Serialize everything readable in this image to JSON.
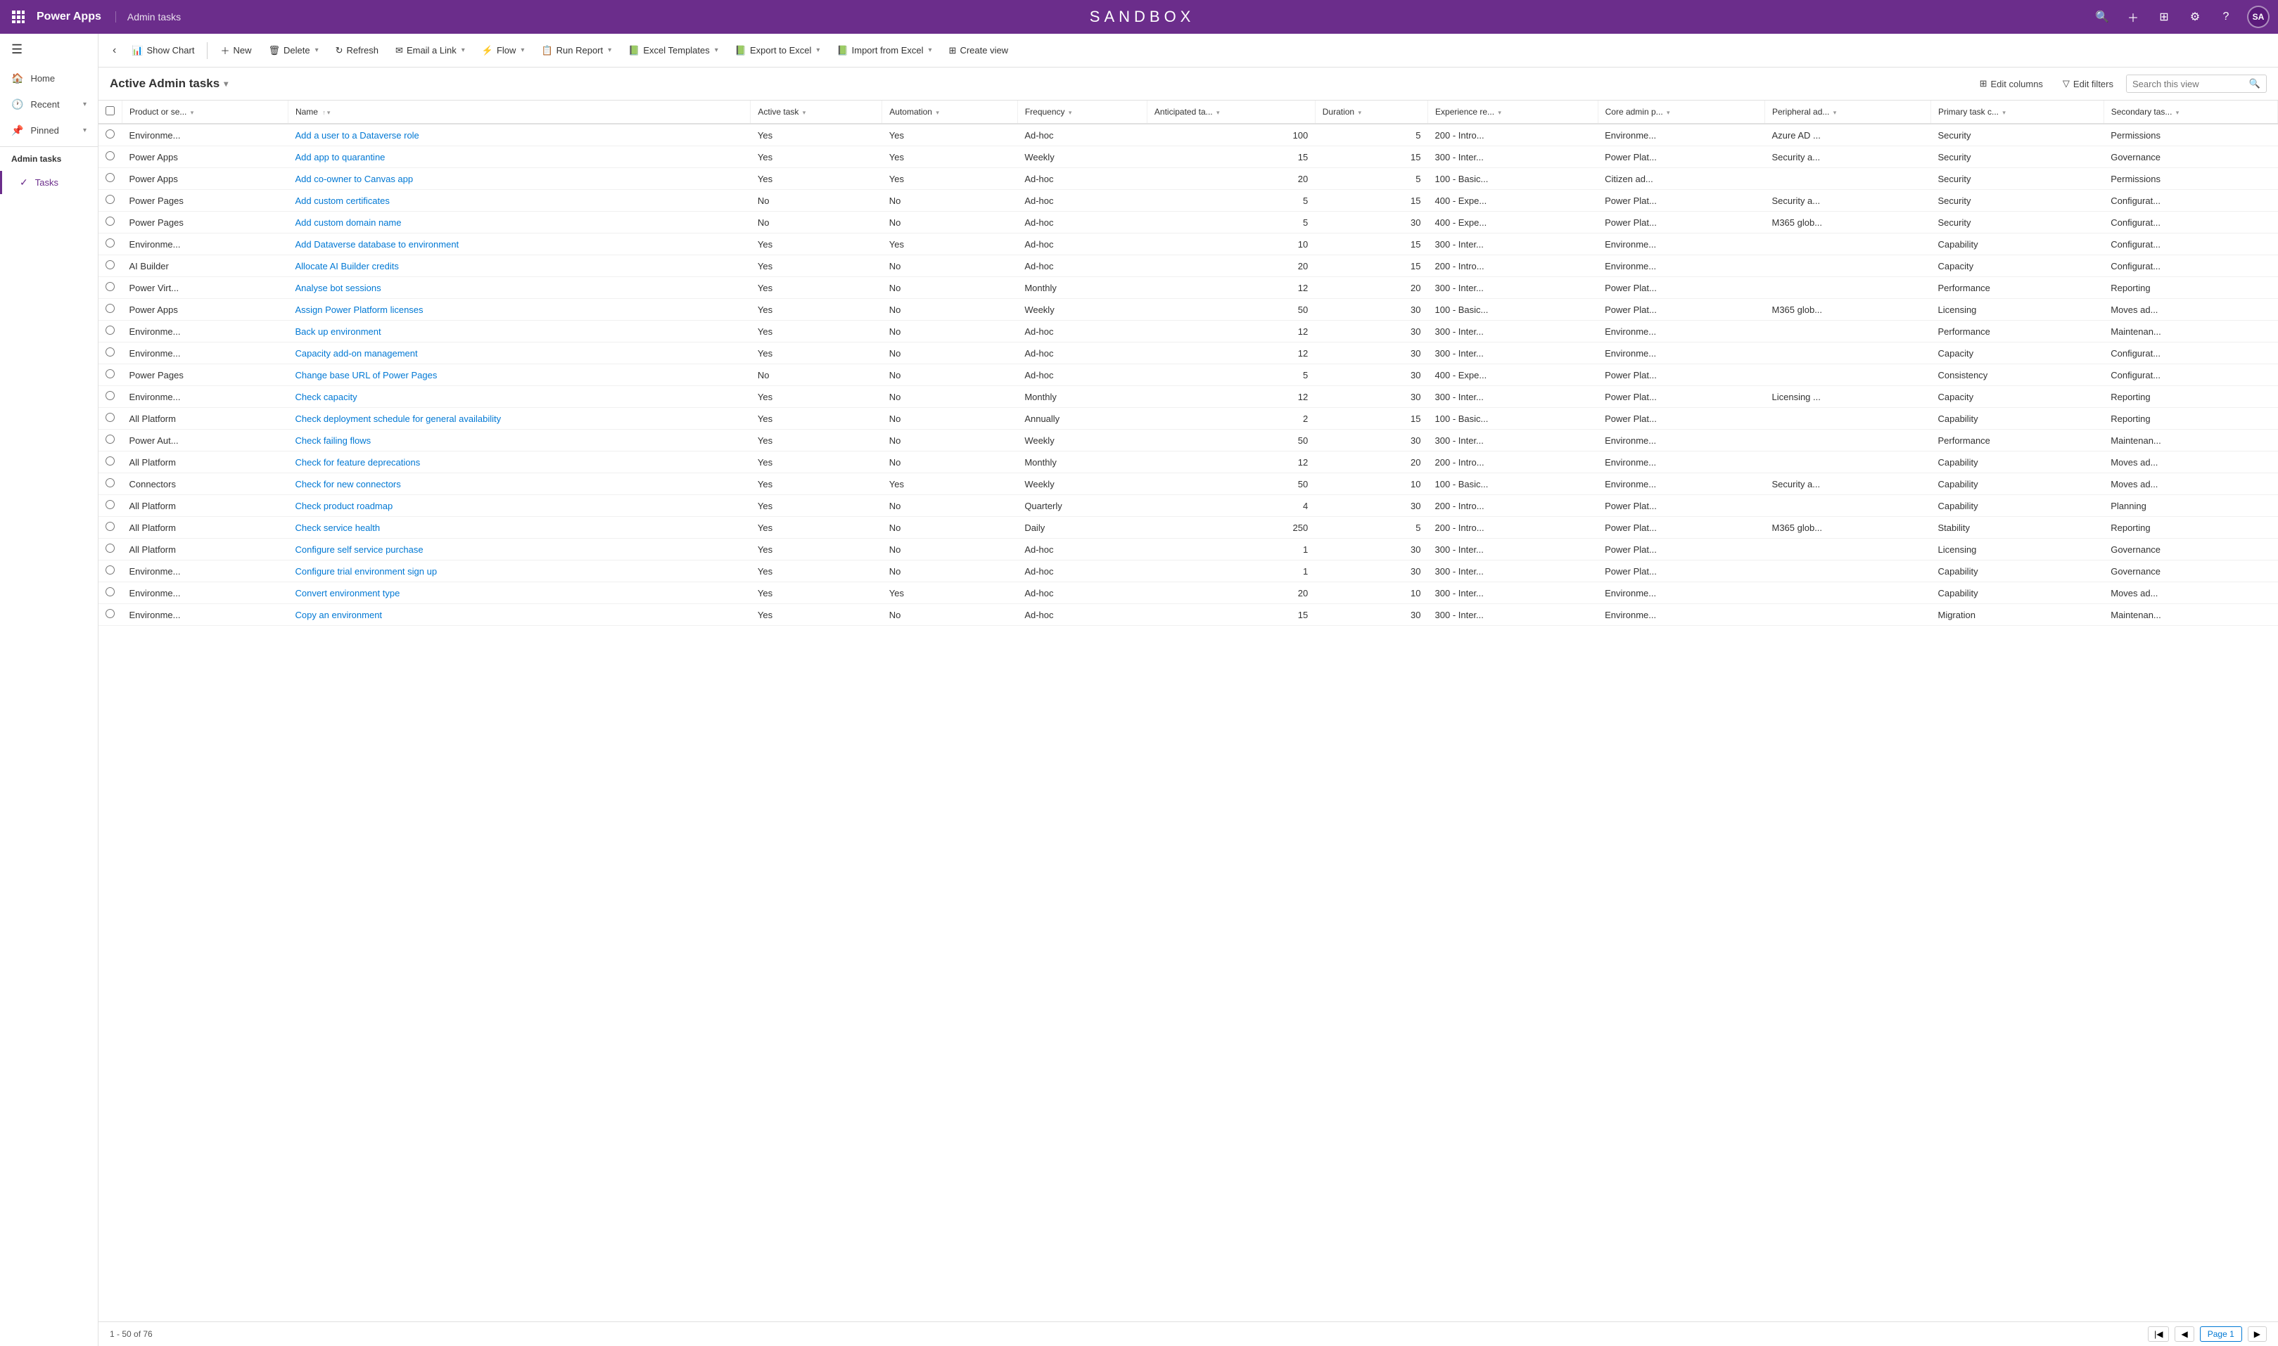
{
  "topNav": {
    "appName": "Power Apps",
    "sectionTitle": "Admin tasks",
    "sandboxTitle": "SANDBOX",
    "avatarInitials": "SA"
  },
  "sidebar": {
    "toggleIcon": "☰",
    "items": [
      {
        "id": "home",
        "label": "Home",
        "icon": "🏠"
      },
      {
        "id": "recent",
        "label": "Recent",
        "icon": "🕐",
        "hasArrow": true
      },
      {
        "id": "pinned",
        "label": "Pinned",
        "icon": "📌",
        "hasArrow": true
      }
    ],
    "section": {
      "label": "Admin tasks",
      "subItems": [
        {
          "id": "tasks",
          "label": "Tasks",
          "icon": "✓",
          "active": true
        }
      ]
    }
  },
  "commandBar": {
    "backLabel": "‹",
    "showChartLabel": "Show Chart",
    "newLabel": "New",
    "deleteLabel": "Delete",
    "refreshLabel": "Refresh",
    "emailLinkLabel": "Email a Link",
    "flowLabel": "Flow",
    "runReportLabel": "Run Report",
    "excelTemplatesLabel": "Excel Templates",
    "exportToExcelLabel": "Export to Excel",
    "importFromExcelLabel": "Import from Excel",
    "createViewLabel": "Create view"
  },
  "viewHeader": {
    "title": "Active Admin tasks",
    "editColumnsLabel": "Edit columns",
    "editFiltersLabel": "Edit filters",
    "searchPlaceholder": "Search this view"
  },
  "table": {
    "columns": [
      {
        "id": "product",
        "label": "Product or se...",
        "hasFilter": true
      },
      {
        "id": "name",
        "label": "Name",
        "hasFilter": true
      },
      {
        "id": "activeTask",
        "label": "Active task",
        "hasFilter": true
      },
      {
        "id": "automation",
        "label": "Automation",
        "hasFilter": true
      },
      {
        "id": "frequency",
        "label": "Frequency",
        "hasFilter": true
      },
      {
        "id": "anticipatedTA",
        "label": "Anticipated ta...",
        "hasFilter": true
      },
      {
        "id": "duration",
        "label": "Duration",
        "hasFilter": true
      },
      {
        "id": "experienceRE",
        "label": "Experience re...",
        "hasFilter": true
      },
      {
        "id": "coreAdminP",
        "label": "Core admin p...",
        "hasFilter": true
      },
      {
        "id": "peripheralAD",
        "label": "Peripheral ad...",
        "hasFilter": true
      },
      {
        "id": "primaryTaskC",
        "label": "Primary task c...",
        "hasFilter": true
      },
      {
        "id": "secondaryTas",
        "label": "Secondary tas...",
        "hasFilter": true
      }
    ],
    "rows": [
      {
        "product": "Environme...",
        "name": "Add a user to a Dataverse role",
        "activeTask": "Yes",
        "automation": "Yes",
        "frequency": "Ad-hoc",
        "anticipatedTA": "100",
        "duration": "5",
        "experienceRE": "200 - Intro...",
        "coreAdminP": "Environme...",
        "peripheralAD": "Azure AD ...",
        "primaryTaskC": "Security",
        "secondaryTas": "Permissions"
      },
      {
        "product": "Power Apps",
        "name": "Add app to quarantine",
        "activeTask": "Yes",
        "automation": "Yes",
        "frequency": "Weekly",
        "anticipatedTA": "15",
        "duration": "15",
        "experienceRE": "300 - Inter...",
        "coreAdminP": "Power Plat...",
        "peripheralAD": "Security a...",
        "primaryTaskC": "Security",
        "secondaryTas": "Governance"
      },
      {
        "product": "Power Apps",
        "name": "Add co-owner to Canvas app",
        "activeTask": "Yes",
        "automation": "Yes",
        "frequency": "Ad-hoc",
        "anticipatedTA": "20",
        "duration": "5",
        "experienceRE": "100 - Basic...",
        "coreAdminP": "Citizen ad...",
        "peripheralAD": "",
        "primaryTaskC": "Security",
        "secondaryTas": "Permissions"
      },
      {
        "product": "Power Pages",
        "name": "Add custom certificates",
        "activeTask": "No",
        "automation": "No",
        "frequency": "Ad-hoc",
        "anticipatedTA": "5",
        "duration": "15",
        "experienceRE": "400 - Expe...",
        "coreAdminP": "Power Plat...",
        "peripheralAD": "Security a...",
        "primaryTaskC": "Security",
        "secondaryTas": "Configurat..."
      },
      {
        "product": "Power Pages",
        "name": "Add custom domain name",
        "activeTask": "No",
        "automation": "No",
        "frequency": "Ad-hoc",
        "anticipatedTA": "5",
        "duration": "30",
        "experienceRE": "400 - Expe...",
        "coreAdminP": "Power Plat...",
        "peripheralAD": "M365 glob...",
        "primaryTaskC": "Security",
        "secondaryTas": "Configurat..."
      },
      {
        "product": "Environme...",
        "name": "Add Dataverse database to environment",
        "activeTask": "Yes",
        "automation": "Yes",
        "frequency": "Ad-hoc",
        "anticipatedTA": "10",
        "duration": "15",
        "experienceRE": "300 - Inter...",
        "coreAdminP": "Environme...",
        "peripheralAD": "",
        "primaryTaskC": "Capability",
        "secondaryTas": "Configurat..."
      },
      {
        "product": "AI Builder",
        "name": "Allocate AI Builder credits",
        "activeTask": "Yes",
        "automation": "No",
        "frequency": "Ad-hoc",
        "anticipatedTA": "20",
        "duration": "15",
        "experienceRE": "200 - Intro...",
        "coreAdminP": "Environme...",
        "peripheralAD": "",
        "primaryTaskC": "Capacity",
        "secondaryTas": "Configurat..."
      },
      {
        "product": "Power Virt...",
        "name": "Analyse bot sessions",
        "activeTask": "Yes",
        "automation": "No",
        "frequency": "Monthly",
        "anticipatedTA": "12",
        "duration": "20",
        "experienceRE": "300 - Inter...",
        "coreAdminP": "Power Plat...",
        "peripheralAD": "",
        "primaryTaskC": "Performance",
        "secondaryTas": "Reporting"
      },
      {
        "product": "Power Apps",
        "name": "Assign Power Platform licenses",
        "activeTask": "Yes",
        "automation": "No",
        "frequency": "Weekly",
        "anticipatedTA": "50",
        "duration": "30",
        "experienceRE": "100 - Basic...",
        "coreAdminP": "Power Plat...",
        "peripheralAD": "M365 glob...",
        "primaryTaskC": "Licensing",
        "secondaryTas": "Moves ad..."
      },
      {
        "product": "Environme...",
        "name": "Back up environment",
        "activeTask": "Yes",
        "automation": "No",
        "frequency": "Ad-hoc",
        "anticipatedTA": "12",
        "duration": "30",
        "experienceRE": "300 - Inter...",
        "coreAdminP": "Environme...",
        "peripheralAD": "",
        "primaryTaskC": "Performance",
        "secondaryTas": "Maintenan..."
      },
      {
        "product": "Environme...",
        "name": "Capacity add-on management",
        "activeTask": "Yes",
        "automation": "No",
        "frequency": "Ad-hoc",
        "anticipatedTA": "12",
        "duration": "30",
        "experienceRE": "300 - Inter...",
        "coreAdminP": "Environme...",
        "peripheralAD": "",
        "primaryTaskC": "Capacity",
        "secondaryTas": "Configurat..."
      },
      {
        "product": "Power Pages",
        "name": "Change base URL of Power Pages",
        "activeTask": "No",
        "automation": "No",
        "frequency": "Ad-hoc",
        "anticipatedTA": "5",
        "duration": "30",
        "experienceRE": "400 - Expe...",
        "coreAdminP": "Power Plat...",
        "peripheralAD": "",
        "primaryTaskC": "Consistency",
        "secondaryTas": "Configurat..."
      },
      {
        "product": "Environme...",
        "name": "Check capacity",
        "activeTask": "Yes",
        "automation": "No",
        "frequency": "Monthly",
        "anticipatedTA": "12",
        "duration": "30",
        "experienceRE": "300 - Inter...",
        "coreAdminP": "Power Plat...",
        "peripheralAD": "Licensing ...",
        "primaryTaskC": "Capacity",
        "secondaryTas": "Reporting"
      },
      {
        "product": "All Platform",
        "name": "Check deployment schedule for general availability",
        "activeTask": "Yes",
        "automation": "No",
        "frequency": "Annually",
        "anticipatedTA": "2",
        "duration": "15",
        "experienceRE": "100 - Basic...",
        "coreAdminP": "Power Plat...",
        "peripheralAD": "",
        "primaryTaskC": "Capability",
        "secondaryTas": "Reporting"
      },
      {
        "product": "Power Aut...",
        "name": "Check failing flows",
        "activeTask": "Yes",
        "automation": "No",
        "frequency": "Weekly",
        "anticipatedTA": "50",
        "duration": "30",
        "experienceRE": "300 - Inter...",
        "coreAdminP": "Environme...",
        "peripheralAD": "",
        "primaryTaskC": "Performance",
        "secondaryTas": "Maintenan..."
      },
      {
        "product": "All Platform",
        "name": "Check for feature deprecations",
        "activeTask": "Yes",
        "automation": "No",
        "frequency": "Monthly",
        "anticipatedTA": "12",
        "duration": "20",
        "experienceRE": "200 - Intro...",
        "coreAdminP": "Environme...",
        "peripheralAD": "",
        "primaryTaskC": "Capability",
        "secondaryTas": "Moves ad..."
      },
      {
        "product": "Connectors",
        "name": "Check for new connectors",
        "activeTask": "Yes",
        "automation": "Yes",
        "frequency": "Weekly",
        "anticipatedTA": "50",
        "duration": "10",
        "experienceRE": "100 - Basic...",
        "coreAdminP": "Environme...",
        "peripheralAD": "Security a...",
        "primaryTaskC": "Capability",
        "secondaryTas": "Moves ad..."
      },
      {
        "product": "All Platform",
        "name": "Check product roadmap",
        "activeTask": "Yes",
        "automation": "No",
        "frequency": "Quarterly",
        "anticipatedTA": "4",
        "duration": "30",
        "experienceRE": "200 - Intro...",
        "coreAdminP": "Power Plat...",
        "peripheralAD": "",
        "primaryTaskC": "Capability",
        "secondaryTas": "Planning"
      },
      {
        "product": "All Platform",
        "name": "Check service health",
        "activeTask": "Yes",
        "automation": "No",
        "frequency": "Daily",
        "anticipatedTA": "250",
        "duration": "5",
        "experienceRE": "200 - Intro...",
        "coreAdminP": "Power Plat...",
        "peripheralAD": "M365 glob...",
        "primaryTaskC": "Stability",
        "secondaryTas": "Reporting"
      },
      {
        "product": "All Platform",
        "name": "Configure self service purchase",
        "activeTask": "Yes",
        "automation": "No",
        "frequency": "Ad-hoc",
        "anticipatedTA": "1",
        "duration": "30",
        "experienceRE": "300 - Inter...",
        "coreAdminP": "Power Plat...",
        "peripheralAD": "",
        "primaryTaskC": "Licensing",
        "secondaryTas": "Governance"
      },
      {
        "product": "Environme...",
        "name": "Configure trial environment sign up",
        "activeTask": "Yes",
        "automation": "No",
        "frequency": "Ad-hoc",
        "anticipatedTA": "1",
        "duration": "30",
        "experienceRE": "300 - Inter...",
        "coreAdminP": "Power Plat...",
        "peripheralAD": "",
        "primaryTaskC": "Capability",
        "secondaryTas": "Governance"
      },
      {
        "product": "Environme...",
        "name": "Convert environment type",
        "activeTask": "Yes",
        "automation": "Yes",
        "frequency": "Ad-hoc",
        "anticipatedTA": "20",
        "duration": "10",
        "experienceRE": "300 - Inter...",
        "coreAdminP": "Environme...",
        "peripheralAD": "",
        "primaryTaskC": "Capability",
        "secondaryTas": "Moves ad..."
      },
      {
        "product": "Environme...",
        "name": "Copy an environment",
        "activeTask": "Yes",
        "automation": "No",
        "frequency": "Ad-hoc",
        "anticipatedTA": "15",
        "duration": "30",
        "experienceRE": "300 - Inter...",
        "coreAdminP": "Environme...",
        "peripheralAD": "",
        "primaryTaskC": "Migration",
        "secondaryTas": "Maintenan..."
      }
    ]
  },
  "statusBar": {
    "recordCount": "1 - 50 of 76",
    "pageLabel": "Page 1"
  }
}
